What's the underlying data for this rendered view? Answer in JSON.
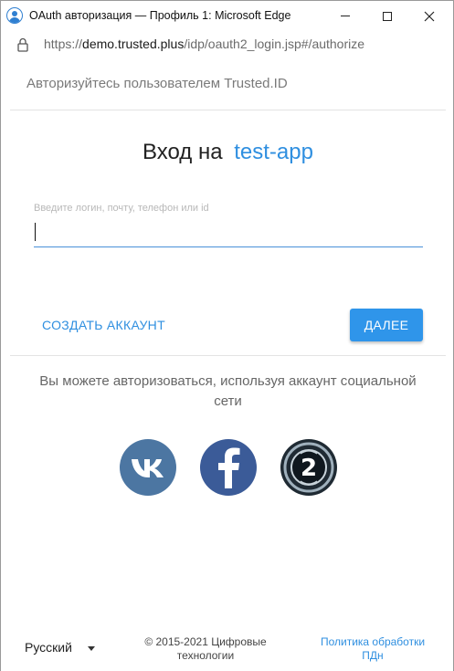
{
  "window": {
    "title": "OAuth авторизация — Профиль 1: Microsoft Edge"
  },
  "address_bar": {
    "scheme": "https://",
    "host": "demo.trusted.plus",
    "path": "/idp/oauth2_login.jsp#/authorize"
  },
  "header": {
    "text": "Авторизуйтесь пользователем Trusted.ID"
  },
  "login": {
    "title_prefix": "Вход на",
    "app_name": "test-app",
    "input_label": "Введите логин, почту, телефон или id",
    "input_value": ""
  },
  "actions": {
    "create_account": "СОЗДАТЬ АККАУНТ",
    "next": "ДАЛЕЕ"
  },
  "social": {
    "text": "Вы можете авторизоваться, используя аккаунт социальной сети",
    "providers": [
      {
        "name": "vk-icon",
        "color": "#4c76a2"
      },
      {
        "name": "facebook-icon",
        "color": "#3b5b98"
      },
      {
        "name": "oauth2-icon",
        "color": "#1f2a33",
        "label": "2"
      }
    ]
  },
  "footer": {
    "language": "Русский",
    "copyright": "© 2015-2021 Цифровые технологии",
    "policy": "Политика обработки ПДн"
  },
  "colors": {
    "accent": "#2f95ea",
    "link": "#2f8fe0"
  }
}
